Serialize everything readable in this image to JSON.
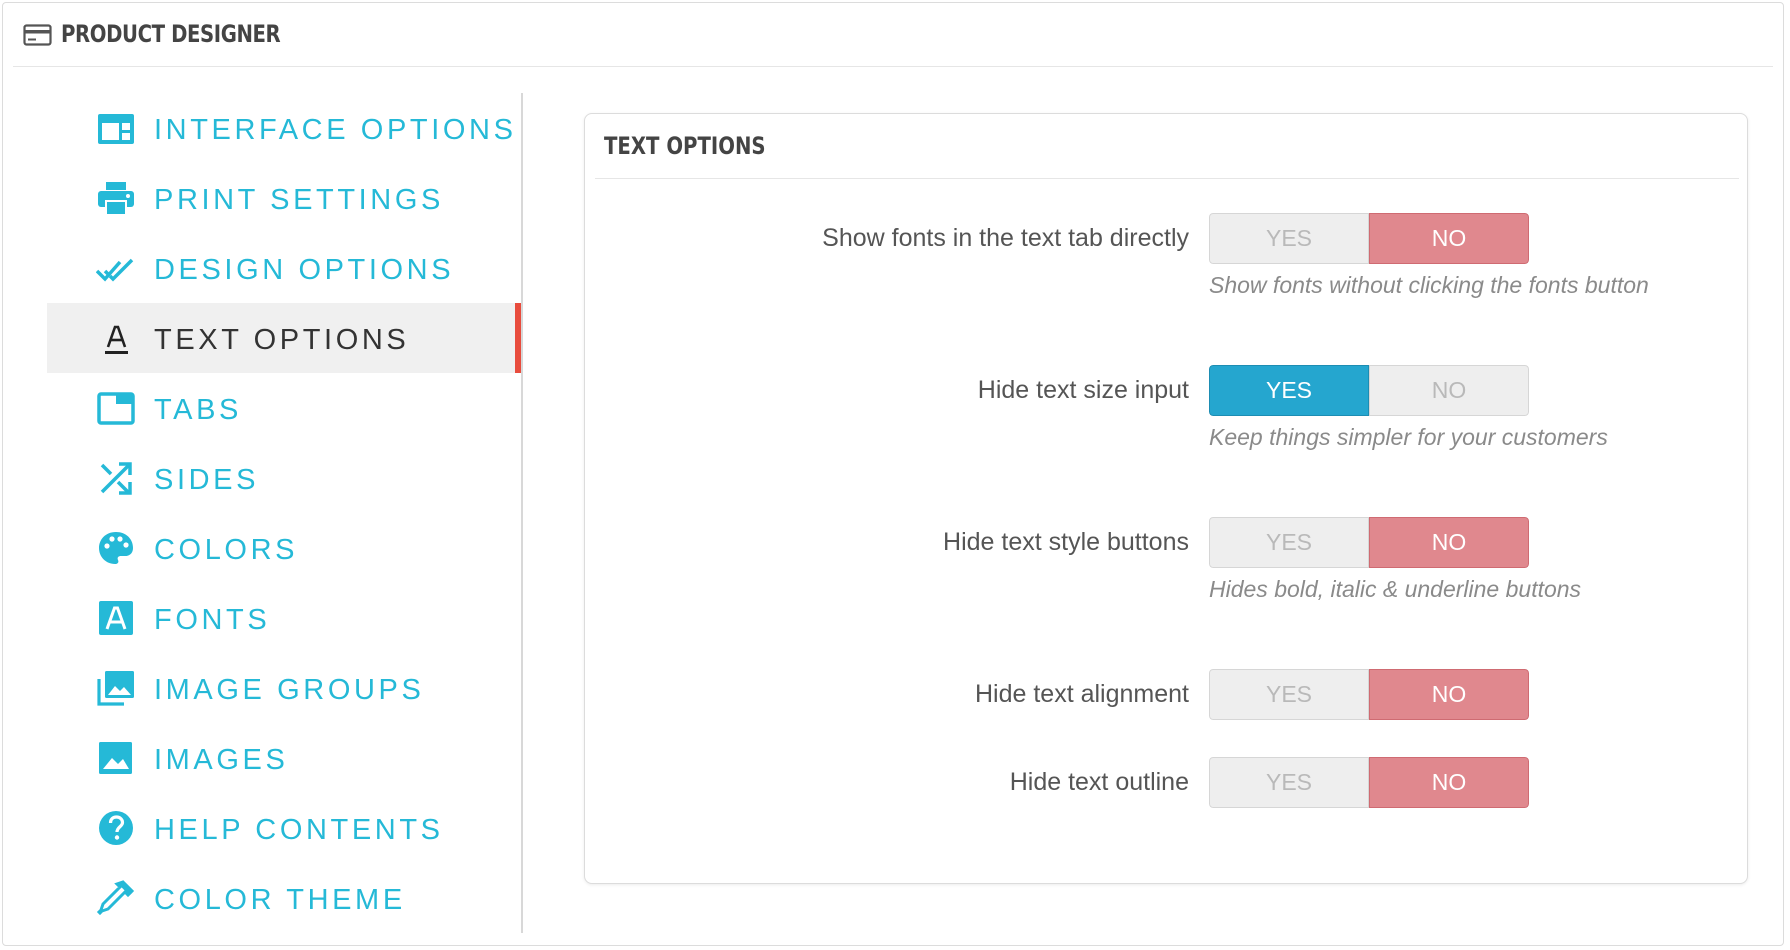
{
  "header": {
    "title": "PRODUCT DESIGNER",
    "icon": "credit-card-icon"
  },
  "colors": {
    "accent": "#25b9d7",
    "active_bar": "#e84c3d",
    "toggle_yes": "#25a6cf",
    "toggle_no": "#e0888e"
  },
  "sidebar": {
    "items": [
      {
        "label": "INTERFACE OPTIONS",
        "icon": "layout-icon",
        "active": false
      },
      {
        "label": "PRINT SETTINGS",
        "icon": "printer-icon",
        "active": false
      },
      {
        "label": "DESIGN OPTIONS",
        "icon": "double-check-icon",
        "active": false
      },
      {
        "label": "TEXT OPTIONS",
        "icon": "text-format-icon",
        "active": true
      },
      {
        "label": "TABS",
        "icon": "tab-icon",
        "active": false
      },
      {
        "label": "SIDES",
        "icon": "shuffle-icon",
        "active": false
      },
      {
        "label": "COLORS",
        "icon": "palette-icon",
        "active": false
      },
      {
        "label": "FONTS",
        "icon": "font-icon",
        "active": false
      },
      {
        "label": "IMAGE GROUPS",
        "icon": "image-group-icon",
        "active": false
      },
      {
        "label": "IMAGES",
        "icon": "image-icon",
        "active": false
      },
      {
        "label": "HELP CONTENTS",
        "icon": "help-icon",
        "active": false
      },
      {
        "label": "COLOR THEME",
        "icon": "eyedropper-icon",
        "active": false
      }
    ]
  },
  "panel": {
    "title": "TEXT OPTIONS",
    "options": [
      {
        "label": "Show fonts in the text tab directly",
        "yes": "YES",
        "no": "NO",
        "value": "NO",
        "help": "Show fonts without clicking the fonts button"
      },
      {
        "label": "Hide text size input",
        "yes": "YES",
        "no": "NO",
        "value": "YES",
        "help": "Keep things simpler for your customers"
      },
      {
        "label": "Hide text style buttons",
        "yes": "YES",
        "no": "NO",
        "value": "NO",
        "help": "Hides bold, italic & underline buttons"
      },
      {
        "label": "Hide text alignment",
        "yes": "YES",
        "no": "NO",
        "value": "NO",
        "help": ""
      },
      {
        "label": "Hide text outline",
        "yes": "YES",
        "no": "NO",
        "value": "NO",
        "help": ""
      }
    ]
  }
}
